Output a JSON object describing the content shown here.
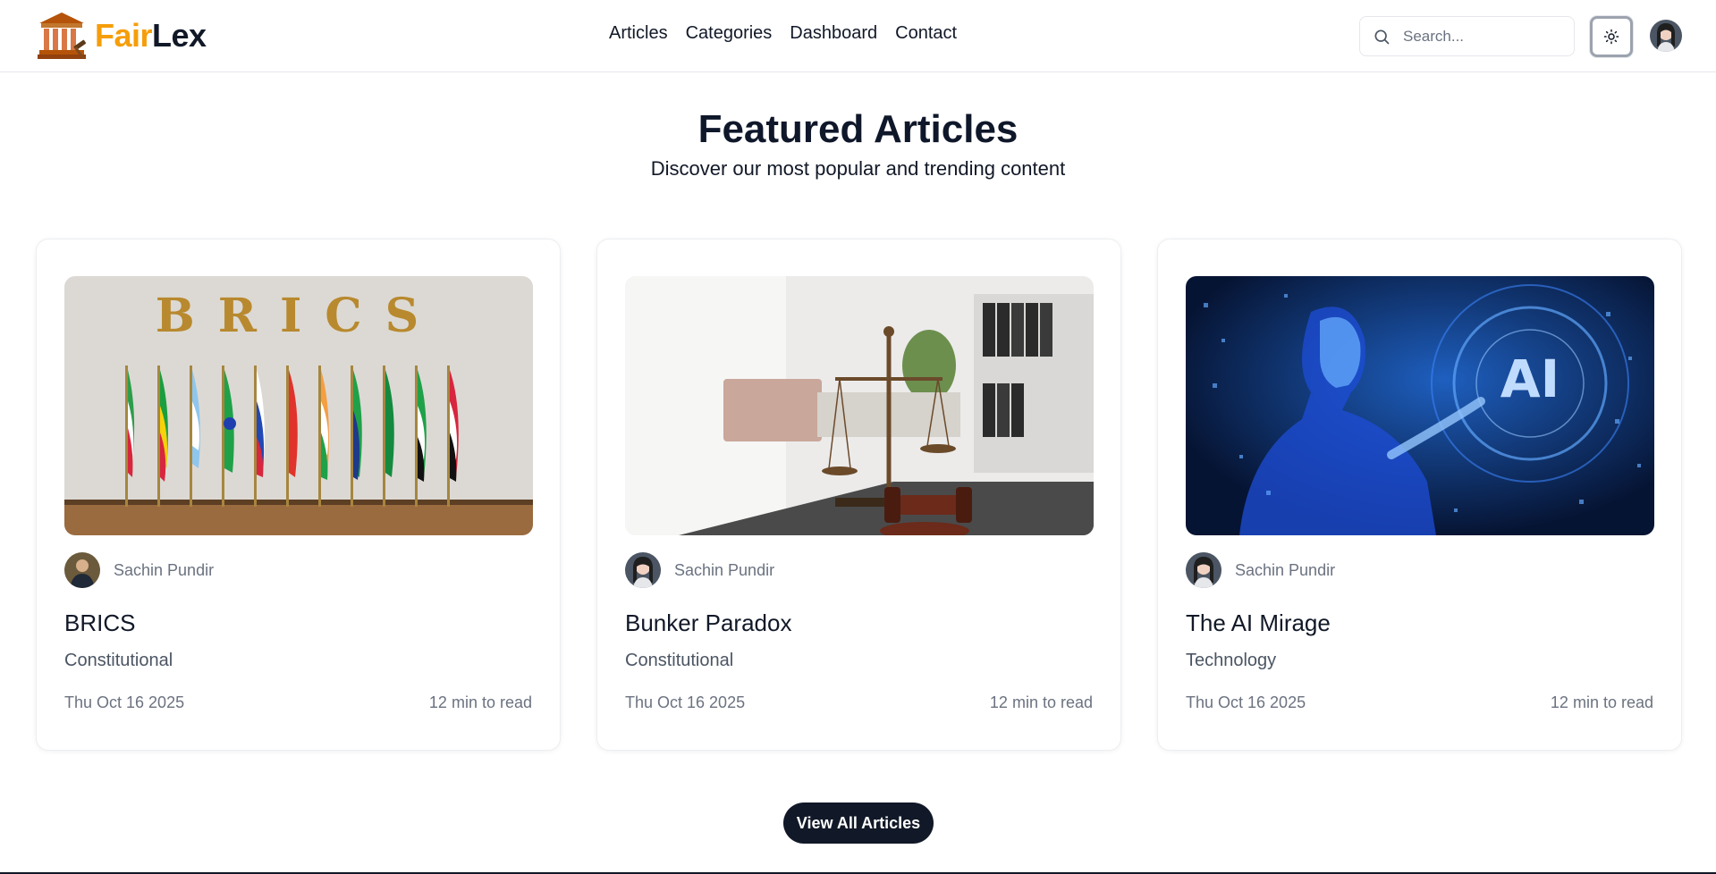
{
  "brand": {
    "part1": "Fair",
    "part2": "Lex",
    "part1_color": "#f59e0b",
    "part2_color": "#111827"
  },
  "nav": {
    "items": [
      {
        "label": "Articles"
      },
      {
        "label": "Categories"
      },
      {
        "label": "Dashboard"
      },
      {
        "label": "Contact"
      }
    ]
  },
  "search": {
    "placeholder": "Search..."
  },
  "theme_toggle": {
    "icon": "sun-icon"
  },
  "hero": {
    "title": "Featured Articles",
    "subtitle": "Discover our most popular and trending content"
  },
  "articles": [
    {
      "image": "brics-flags",
      "author": "Sachin Pundir",
      "title": "BRICS",
      "category": "Constitutional",
      "date": "Thu Oct 16 2025",
      "read_time": "12 min to read"
    },
    {
      "image": "scales-of-justice",
      "author": "Sachin Pundir",
      "title": "Bunker Paradox",
      "category": "Constitutional",
      "date": "Thu Oct 16 2025",
      "read_time": "12 min to read"
    },
    {
      "image": "ai-humanoid",
      "author": "Sachin Pundir",
      "title": "The AI Mirage",
      "category": "Technology",
      "date": "Thu Oct 16 2025",
      "read_time": "12 min to read"
    }
  ],
  "image_text": {
    "brics": "BRICS",
    "ai": "AI"
  },
  "cta": {
    "label": "View All Articles"
  },
  "colors": {
    "accent": "#f59e0b",
    "dark": "#111827",
    "muted": "#6b7280"
  }
}
